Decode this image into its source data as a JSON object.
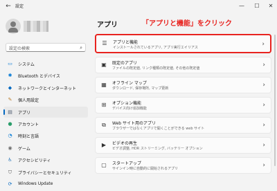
{
  "window": {
    "back_icon": "←",
    "title": "設定",
    "minimize_icon": "—",
    "maximize_icon": "☐",
    "close_icon": "✕"
  },
  "search": {
    "placeholder": "設定の検索",
    "icon": "⌕"
  },
  "sidebar": {
    "items": [
      {
        "label": "システム",
        "icon": "▭",
        "color": "#0078d4",
        "active": false
      },
      {
        "label": "Bluetooth とデバイス",
        "icon": "✱",
        "color": "#0078d4",
        "active": false
      },
      {
        "label": "ネットワークとインターネット",
        "icon": "◆",
        "color": "#0067c0",
        "active": false
      },
      {
        "label": "個人用設定",
        "icon": "✎",
        "color": "#b87a2a",
        "active": false
      },
      {
        "label": "アプリ",
        "icon": "▤",
        "color": "#4a5a6e",
        "active": true
      },
      {
        "label": "アカウント",
        "icon": "●",
        "color": "#2a9d6a",
        "active": false
      },
      {
        "label": "時刻と言語",
        "icon": "◔",
        "color": "#0078d4",
        "active": false
      },
      {
        "label": "ゲーム",
        "icon": "◉",
        "color": "#6b6b6b",
        "active": false
      },
      {
        "label": "アクセシビリティ",
        "icon": "♿",
        "color": "#1f6fb5",
        "active": false
      },
      {
        "label": "プライバシーとセキュリティ",
        "icon": "⛉",
        "color": "#5a5a5a",
        "active": false
      },
      {
        "label": "Windows Update",
        "icon": "⟳",
        "color": "#0067c0",
        "active": false
      }
    ]
  },
  "main": {
    "title": "アプリ",
    "annotation": "「アプリと機能」をクリック",
    "cards": [
      {
        "title": "アプリと機能",
        "subtitle": "インストールされているアプリ, アプリ実行エイリアス",
        "icon": "☰",
        "highlight": true
      },
      {
        "title": "既定のアプリ",
        "subtitle": "ファイルの既定値, リンク種類の既定値, その他の既定値",
        "icon": "▣",
        "highlight": false
      },
      {
        "title": "オフライン マップ",
        "subtitle": "ダウンロード, 保存場所, マップ更新",
        "icon": "▦",
        "highlight": false
      },
      {
        "title": "オプション機能",
        "subtitle": "デバイス向け追加機能",
        "icon": "⊞",
        "highlight": false
      },
      {
        "title": "Web サイト用のアプリ",
        "subtitle": "ブラウザーではなくアプリで開くことができる web サイト",
        "icon": "⧉",
        "highlight": false
      },
      {
        "title": "ビデオの再生",
        "subtitle": "ビデオ調整, HDR ストリーミング, バッテリー オプション",
        "icon": "▶",
        "highlight": false
      },
      {
        "title": "スタートアップ",
        "subtitle": "サインイン時に自動的に開始されるアプリ",
        "icon": "▢",
        "highlight": false
      }
    ],
    "chevron": "›"
  },
  "colors": {
    "accent": "#0067c0",
    "annotation": "#e8231f"
  }
}
